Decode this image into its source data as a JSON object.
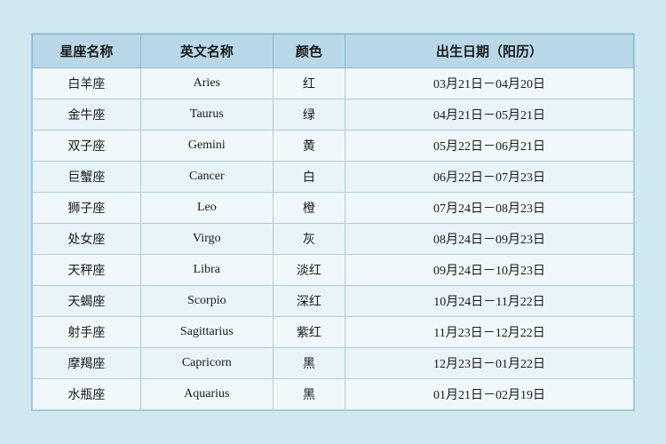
{
  "table": {
    "headers": {
      "zh_name": "星座名称",
      "en_name": "英文名称",
      "color": "颜色",
      "date_range": "出生日期（阳历）"
    },
    "rows": [
      {
        "zh": "白羊座",
        "en": "Aries",
        "color": "红",
        "date": "03月21日－04月20日"
      },
      {
        "zh": "金牛座",
        "en": "Taurus",
        "color": "绿",
        "date": "04月21日－05月21日"
      },
      {
        "zh": "双子座",
        "en": "Gemini",
        "color": "黄",
        "date": "05月22日－06月21日"
      },
      {
        "zh": "巨蟹座",
        "en": "Cancer",
        "color": "白",
        "date": "06月22日－07月23日"
      },
      {
        "zh": "狮子座",
        "en": "Leo",
        "color": "橙",
        "date": "07月24日－08月23日"
      },
      {
        "zh": "处女座",
        "en": "Virgo",
        "color": "灰",
        "date": "08月24日－09月23日"
      },
      {
        "zh": "天秤座",
        "en": "Libra",
        "color": "淡红",
        "date": "09月24日－10月23日"
      },
      {
        "zh": "天蝎座",
        "en": "Scorpio",
        "color": "深红",
        "date": "10月24日－11月22日"
      },
      {
        "zh": "射手座",
        "en": "Sagittarius",
        "color": "紫红",
        "date": "11月23日－12月22日"
      },
      {
        "zh": "摩羯座",
        "en": "Capricorn",
        "color": "黑",
        "date": "12月23日－01月22日"
      },
      {
        "zh": "水瓶座",
        "en": "Aquarius",
        "color": "黑",
        "date": "01月21日－02月19日"
      }
    ]
  }
}
